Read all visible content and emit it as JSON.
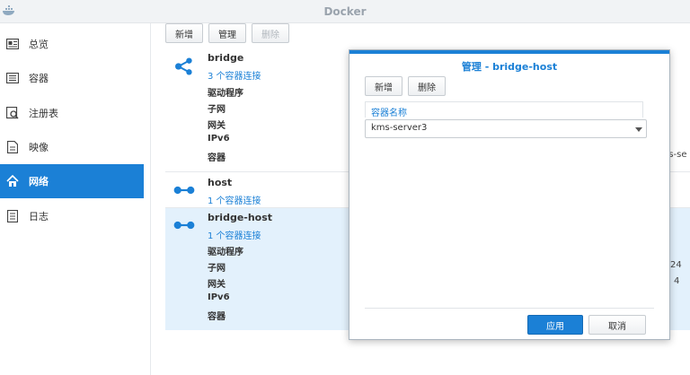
{
  "window": {
    "title": "Docker"
  },
  "sidebar": {
    "items": [
      {
        "label": "总览",
        "icon": "overview-icon"
      },
      {
        "label": "容器",
        "icon": "container-icon"
      },
      {
        "label": "注册表",
        "icon": "registry-icon"
      },
      {
        "label": "映像",
        "icon": "image-icon"
      },
      {
        "label": "网络",
        "icon": "network-icon",
        "active": true
      },
      {
        "label": "日志",
        "icon": "log-icon"
      }
    ]
  },
  "toolbar": {
    "add": "新增",
    "manage": "管理",
    "delete": "删除"
  },
  "networks": [
    {
      "name": "bridge",
      "link": "3 个容器连接",
      "props": [
        "驱动程序",
        "子网",
        "网关",
        "IPv6",
        "容器"
      ],
      "trail": "ns-se"
    },
    {
      "name": "host",
      "link": "1 个容器连接"
    },
    {
      "name": "bridge-host",
      "link": "1 个容器连接",
      "props": [
        "驱动程序",
        "子网",
        "网关",
        "IPv6",
        "容器"
      ],
      "trail_subnet": "24",
      "trail_gateway": "4"
    }
  ],
  "dialog": {
    "title": "管理 - bridge-host",
    "add": "新增",
    "delete": "删除",
    "column_header": "容器名称",
    "selected_value": "kms-server3",
    "apply": "应用",
    "cancel": "取消"
  },
  "colors": {
    "accent": "#1b80d6",
    "selected_row": "#e3f1fc"
  }
}
